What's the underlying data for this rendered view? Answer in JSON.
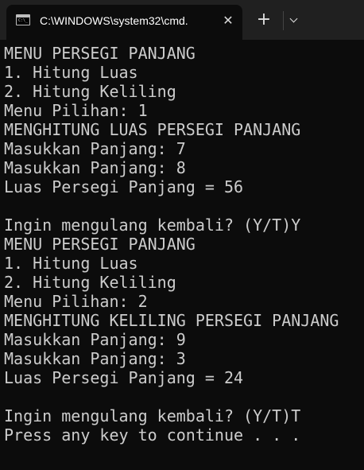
{
  "window": {
    "tab_title": "C:\\WINDOWS\\system32\\cmd.",
    "tab_close_label": "✕",
    "new_tab_label": "+",
    "tab_icon_text": "C:\\_",
    "tab_icon": "cmd-icon",
    "dropdown_icon": "chevron-down-icon"
  },
  "terminal": {
    "lines": [
      "MENU PERSEGI PANJANG",
      "1. Hitung Luas",
      "2. Hitung Keliling",
      "Menu Pilihan: 1",
      "MENGHITUNG LUAS PERSEGI PANJANG",
      "Masukkan Panjang: 7",
      "Masukkan Panjang: 8",
      "Luas Persegi Panjang = 56",
      "",
      "Ingin mengulang kembali? (Y/T)Y",
      "MENU PERSEGI PANJANG",
      "1. Hitung Luas",
      "2. Hitung Keliling",
      "Menu Pilihan: 2",
      "MENGHITUNG KELILING PERSEGI PANJANG",
      "Masukkan Panjang: 9",
      "Masukkan Panjang: 3",
      "Luas Persegi Panjang = 24",
      "",
      "Ingin mengulang kembali? (Y/T)T",
      "Press any key to continue . . ."
    ]
  },
  "colors": {
    "titlebar": "#202020",
    "terminal_bg": "#0c0c0c",
    "terminal_text": "#cccccc"
  }
}
